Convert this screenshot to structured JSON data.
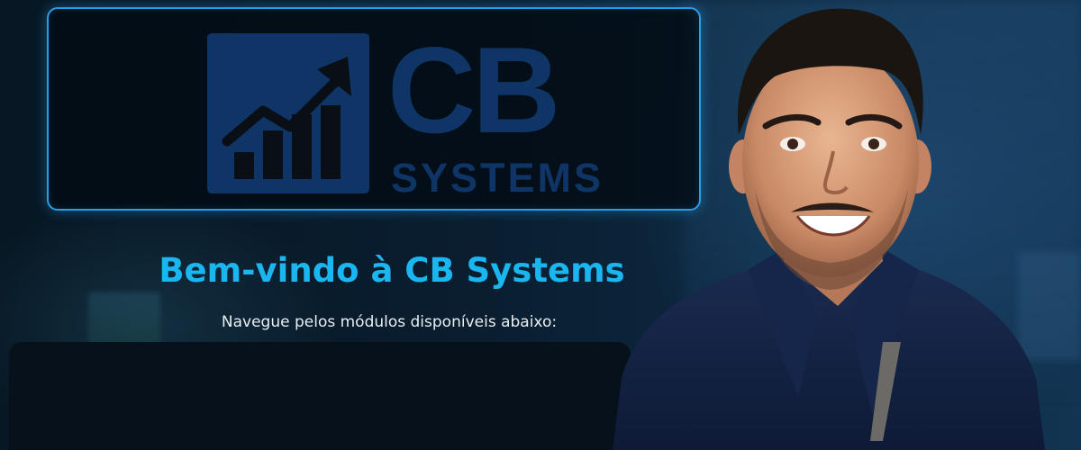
{
  "logo": {
    "mark_icon": "rising-chart-arrow-icon",
    "wordmark": "CB",
    "subword": "SYSTEMS",
    "color": "#0f3566",
    "border_color": "#2a9de8"
  },
  "hero": {
    "title": "Bem-vindo à CB Systems",
    "subtitle": "Navegue pelos módulos disponíveis abaixo:",
    "title_color": "#19b6f0"
  },
  "modules": {
    "items": []
  },
  "image": {
    "subject": "smiling-man-portrait"
  }
}
